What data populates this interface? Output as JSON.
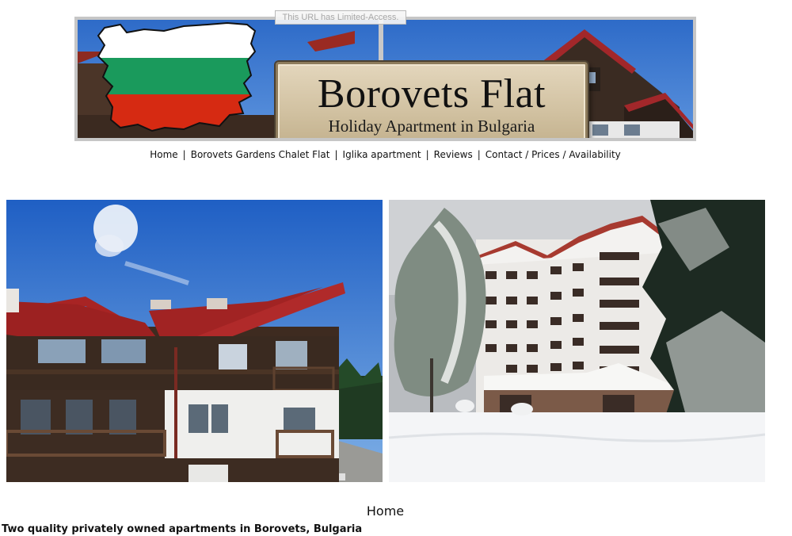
{
  "banner": {
    "limited_access": "This URL has Limited-Access.",
    "title": "Borovets Flat",
    "subtitle": "Holiday Apartment in Bulgaria",
    "flag_colors": [
      "#ffffff",
      "#1a9a5c",
      "#d62a12"
    ],
    "logo_icon": "bulgaria-map-flag-icon"
  },
  "nav": {
    "items": [
      "Home",
      "Borovets Gardens Chalet Flat",
      "Iglika apartment",
      "Reviews",
      "Contact / Prices / Availability"
    ],
    "separator": "|"
  },
  "photos": {
    "left_icon": "chalet-summer-photo",
    "right_icon": "hotel-winter-photo"
  },
  "main": {
    "heading": "Home",
    "intro": "Two quality privately owned apartments in Borovets, Bulgaria"
  }
}
